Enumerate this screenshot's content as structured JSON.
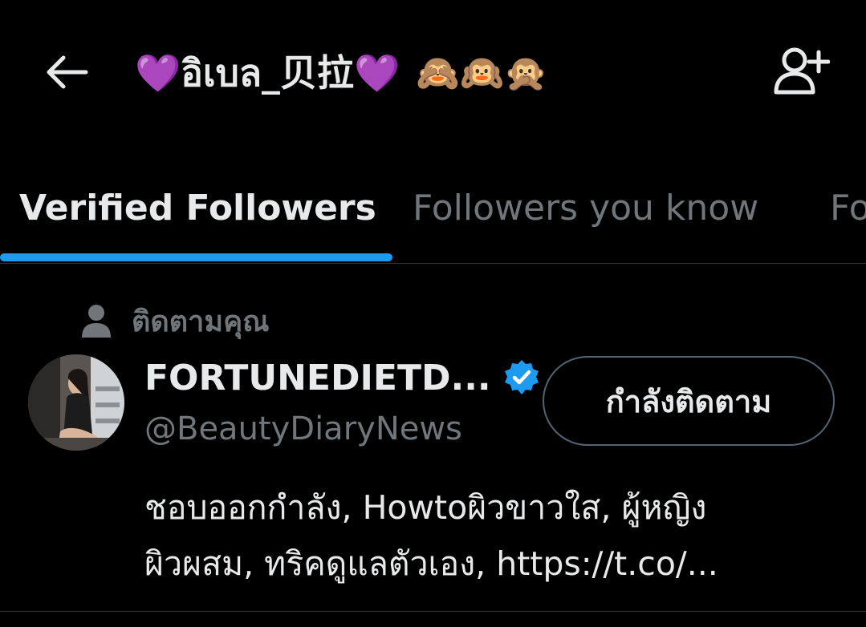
{
  "header": {
    "back_icon": "arrow-left-icon",
    "title": "💜อิเบล_贝拉💜",
    "title_emojis": "🙈🙉🙊",
    "add_user_icon": "person-add-icon"
  },
  "tabs": [
    {
      "label": "Verified Followers",
      "active": true
    },
    {
      "label": "Followers you know",
      "active": false
    },
    {
      "label": "Followers",
      "active": false
    }
  ],
  "colors": {
    "background": "#000000",
    "text_primary": "#e7e9ea",
    "text_secondary": "#71767b",
    "accent": "#1d9bf0",
    "border": "#2f3336"
  },
  "follower": {
    "follows_you_icon": "person-icon",
    "follows_you_label": "ติดตามคุณ",
    "display_name": "FORTUNEDIETD...",
    "verified_icon": "verified-badge-icon",
    "handle": "@BeautyDiaryNews",
    "follow_button_label": "กำลังติดตาม",
    "bio_line_1": "ชอบออกกำลัง, Howtoผิวขาวใส, ผู้หญิง",
    "bio_line_2": "ผิวผสม, ทริคดูแลตัวเอง, https://t.co/..."
  }
}
